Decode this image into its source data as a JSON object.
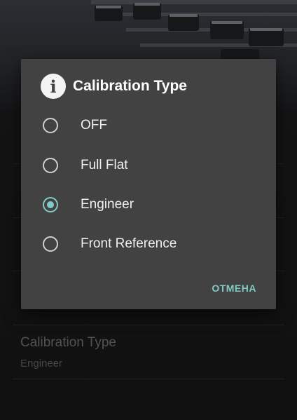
{
  "background": {
    "setting_title": "Calibration Type",
    "setting_value": "Engineer"
  },
  "dialog": {
    "title": "Calibration Type",
    "icon": "info-icon",
    "options": [
      {
        "label": "OFF",
        "checked": false
      },
      {
        "label": "Full Flat",
        "checked": false
      },
      {
        "label": "Engineer",
        "checked": true
      },
      {
        "label": "Front Reference",
        "checked": false
      }
    ],
    "cancel_label": "ОТМЕНА"
  },
  "colors": {
    "accent": "#80cbc4",
    "dialog_bg": "#424242"
  }
}
